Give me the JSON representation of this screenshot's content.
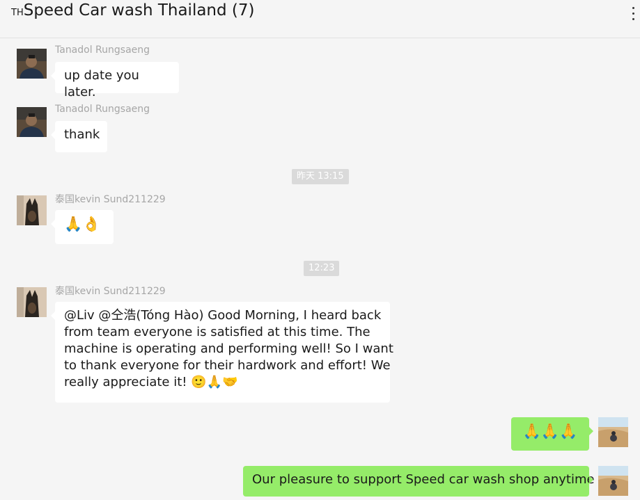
{
  "chat": {
    "flag": "TH",
    "title": "Speed Car wash Thailand (7)"
  },
  "messages": [
    {
      "sender": "Tanadol Rungsaeng",
      "text": "up date you later."
    },
    {
      "sender": "Tanadol Rungsaeng",
      "text": "thank"
    },
    {
      "timestamp": "昨天 13:15"
    },
    {
      "sender": "泰国kevin Sund211229",
      "text": "🙏👌"
    },
    {
      "timestamp": "12:23"
    },
    {
      "sender": "泰国kevin Sund211229",
      "lines": [
        "@Liv @仝浩(Tóng Hào) Good Morning, I heard back",
        "from team everyone is satisfied at this time. The",
        "machine is operating and performing well! So I want",
        "to thank everyone for their hardwork and effort! We",
        "really appreciate it! 🙂🙏🤝"
      ]
    },
    {
      "self": true,
      "text": "🙏🙏🙏"
    },
    {
      "self": true,
      "text": "Our pleasure to support Speed car wash shop anytime"
    }
  ],
  "icons": {
    "avatar_tanadol": "avatar-man-icon",
    "avatar_kevin": "avatar-dog-icon",
    "avatar_self": "avatar-desert-icon",
    "more": "more-dots-icon"
  }
}
